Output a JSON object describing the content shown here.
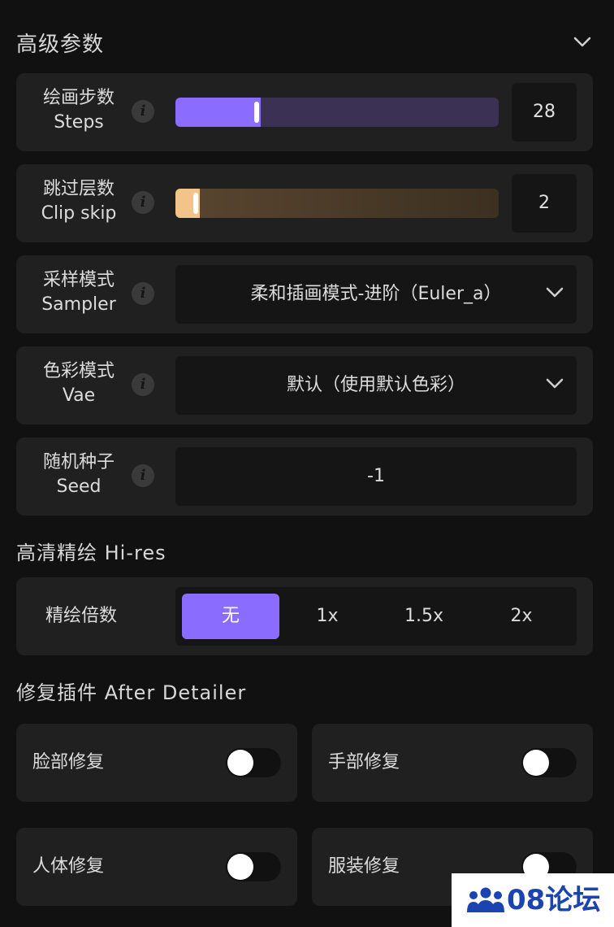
{
  "advanced": {
    "title": "高级参数",
    "steps": {
      "label_cn": "绘画步数",
      "label_en": "Steps",
      "value": "28",
      "fill_fraction": 0.265
    },
    "clip_skip": {
      "label_cn": "跳过层数",
      "label_en": "Clip skip",
      "value": "2",
      "fill_fraction": 0.075
    },
    "sampler": {
      "label_cn": "采样模式",
      "label_en": "Sampler",
      "selected": "柔和插画模式-进阶（Euler_a）"
    },
    "vae": {
      "label_cn": "色彩模式",
      "label_en": "Vae",
      "selected": "默认（使用默认色彩）"
    },
    "seed": {
      "label_cn": "随机种子",
      "label_en": "Seed",
      "value": "-1"
    }
  },
  "hires": {
    "title": "高清精绘 Hi-res",
    "label": "精绘倍数",
    "options": [
      "无",
      "1x",
      "1.5x",
      "2x"
    ],
    "selected_index": 0
  },
  "detailer": {
    "title": "修复插件 After Detailer",
    "toggles": [
      {
        "label": "脸部修复",
        "on": false
      },
      {
        "label": "手部修复",
        "on": false
      },
      {
        "label": "人体修复",
        "on": false
      },
      {
        "label": "服装修复",
        "on": false
      }
    ]
  },
  "watermark": {
    "text": "08论坛",
    "icon": "people-group-icon"
  },
  "colors": {
    "accent": "#8a6cff",
    "steps_track": "#3b3155",
    "clip_fill": "#f2c48a",
    "clip_track": "#4a3b28"
  }
}
